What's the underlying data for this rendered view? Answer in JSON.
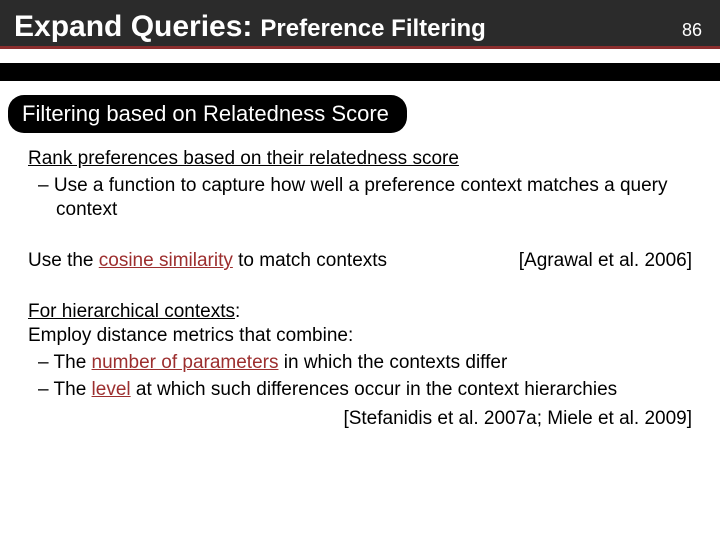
{
  "header": {
    "title_main": "Expand Queries:",
    "title_sub": "Preference Filtering",
    "page_number": "86"
  },
  "section": {
    "pill": "Filtering based on Relatedness Score"
  },
  "body": {
    "p1_head": "Rank preferences based on their relatedness score",
    "p1_bullet": "Use a function to capture how well a preference context matches a query context",
    "p2_pre": "Use the ",
    "p2_em": "cosine similarity",
    "p2_post": " to match contexts",
    "p2_cite": "[Agrawal et al. 2006]",
    "p3_head": "For hierarchical contexts",
    "p3_lead": "Employ distance metrics that combine:",
    "p3_b1_pre": "The ",
    "p3_b1_em": "number of parameters",
    "p3_b1_post": " in which the contexts differ",
    "p3_b2_pre": "The ",
    "p3_b2_em": "level",
    "p3_b2_post": " at which such differences occur in the context hierarchies",
    "p3_cite": "[Stefanidis et al. 2007a; Miele et al. 2009]"
  }
}
